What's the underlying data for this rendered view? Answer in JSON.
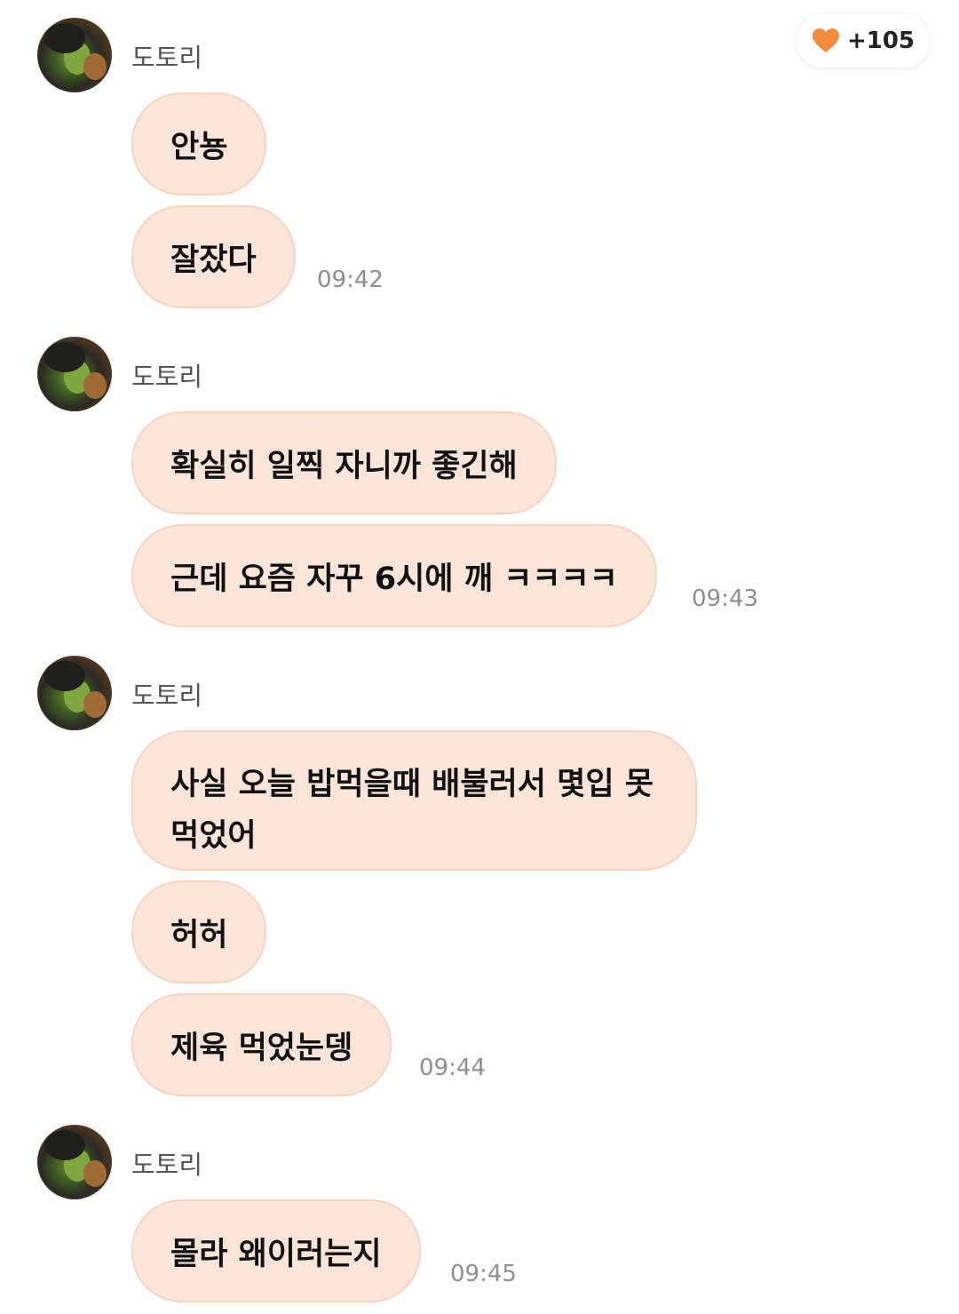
{
  "like_badge": {
    "icon": "heart-icon",
    "color": "#f08a3c",
    "count": "+105"
  },
  "groups": [
    {
      "sender": "도토리",
      "messages": [
        {
          "text": "안뇽"
        },
        {
          "text": "잘잤다"
        }
      ],
      "time": "09:42"
    },
    {
      "sender": "도토리",
      "messages": [
        {
          "text": "확실히 일찍 자니까 좋긴해"
        },
        {
          "text": "근데 요즘 자꾸 6시에 깨 ㅋㅋㅋㅋ"
        }
      ],
      "time": "09:43"
    },
    {
      "sender": "도토리",
      "messages": [
        {
          "text": "사실 오늘 밥먹을때  배불러서 몇입 못먹었어"
        },
        {
          "text": "허허"
        },
        {
          "text": "제육 먹었눈뎅"
        }
      ],
      "time": "09:44"
    },
    {
      "sender": "도토리",
      "messages": [
        {
          "text": "몰라 왜이러는지"
        }
      ],
      "time": "09:45"
    }
  ],
  "colors": {
    "bubble": "#fbe4d8",
    "bubble_border": "#f6d4c2",
    "timestamp": "#8e8e8e"
  }
}
